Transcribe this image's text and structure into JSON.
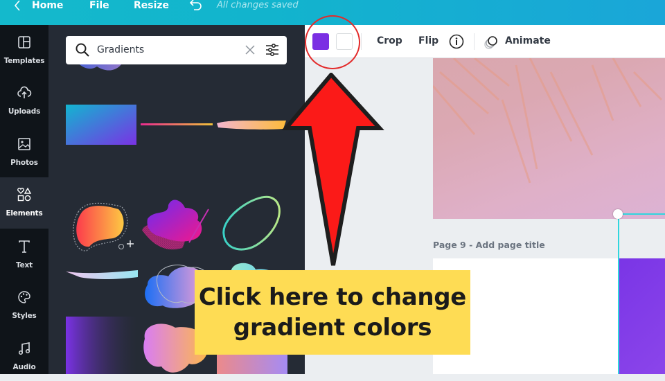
{
  "topbar": {
    "back_icon": "chevron-left-icon",
    "home_label": "Home",
    "file_label": "File",
    "resize_label": "Resize",
    "undo_icon": "undo-icon",
    "save_status": "All changes saved"
  },
  "sidebar": {
    "items": [
      {
        "label": "Templates",
        "icon": "templates-icon"
      },
      {
        "label": "Uploads",
        "icon": "cloud-upload-icon"
      },
      {
        "label": "Photos",
        "icon": "image-icon"
      },
      {
        "label": "Elements",
        "icon": "shapes-icon",
        "active": true
      },
      {
        "label": "Text",
        "icon": "text-icon"
      },
      {
        "label": "Styles",
        "icon": "palette-icon"
      },
      {
        "label": "Audio",
        "icon": "music-note-icon"
      }
    ]
  },
  "panel": {
    "search": {
      "value": "Gradients",
      "search_icon": "search-icon",
      "clear_icon": "close-icon",
      "filter_icon": "filter-sliders-icon"
    },
    "elements": [
      {
        "name": "gradient-blob-blue-purple"
      },
      {
        "name": "gradient-hatched-shapes"
      },
      {
        "name": "gradient-rectangle-cyan-purple"
      },
      {
        "name": "gradient-line-pink-yellow"
      },
      {
        "name": "gradient-brush-stroke-pink-yellow"
      },
      {
        "name": "gradient-blob-red-yellow"
      },
      {
        "name": "gradient-abstract-purple-pink"
      },
      {
        "name": "gradient-ring-teal-green"
      },
      {
        "name": "gradient-brush-stroke-pastel"
      },
      {
        "name": "gradient-cloud-blue-pink"
      },
      {
        "name": "gradient-cloud-mint-blue"
      },
      {
        "name": "gradient-fade-purple-gray"
      },
      {
        "name": "gradient-cloud-pink-orange"
      },
      {
        "name": "gradient-square-coral-violet"
      }
    ]
  },
  "toolbar": {
    "color_swatches": [
      {
        "color": "#7b2fe3",
        "label": "Gradient color 1"
      },
      {
        "color": "#ffffff",
        "label": "Gradient color 2"
      }
    ],
    "crop_label": "Crop",
    "flip_label": "Flip",
    "info_icon": "info-icon",
    "animate_icon": "animate-icon",
    "animate_label": "Animate"
  },
  "canvas": {
    "page_label": "Page 9 - Add page title"
  },
  "annotation": {
    "callout_line1": "Click here to change",
    "callout_line2": "gradient colors",
    "highlight_color": "#e32a2a",
    "callout_color": "#fedc54"
  }
}
